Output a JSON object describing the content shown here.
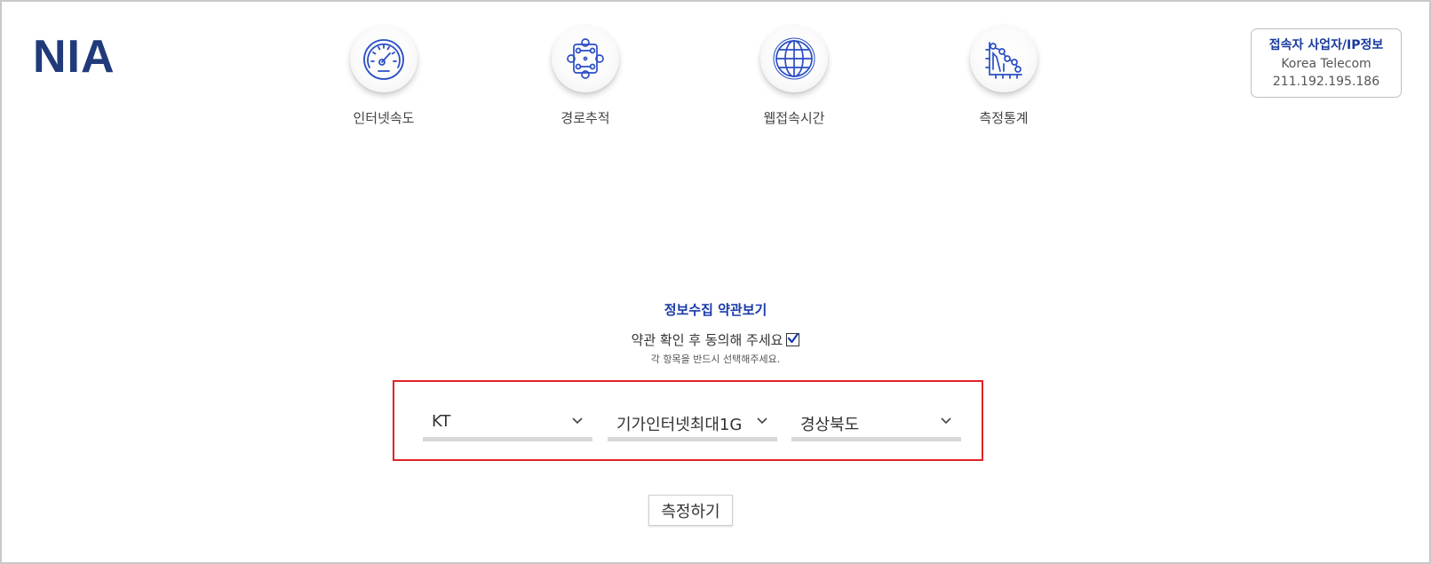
{
  "logo": {
    "text": "NIA",
    "color": "#213a7a"
  },
  "nav": [
    {
      "label": "인터넷속도",
      "icon": "speedometer-icon"
    },
    {
      "label": "경로추적",
      "icon": "route-trace-icon"
    },
    {
      "label": "웹접속시간",
      "icon": "globe-icon"
    },
    {
      "label": "측정통계",
      "icon": "statistics-chart-icon"
    }
  ],
  "ip_info": {
    "title": "접속자 사업자/IP정보",
    "isp": "Korea Telecom",
    "ip": "211.192.195.186"
  },
  "terms": {
    "link": "정보수집 약관보기",
    "agree_label": "약관 확인 후 동의해 주세요",
    "agree_checked": true,
    "hint": "각 항목을 반드시 선택해주세요."
  },
  "selects": [
    {
      "value": "KT"
    },
    {
      "value": "기가인터넷최대1G"
    },
    {
      "value": "경상북도"
    }
  ],
  "measure_button": "측정하기",
  "colors": {
    "accent": "#1a3aa8",
    "highlight_frame": "#e02227",
    "logo": "#213a7a"
  }
}
